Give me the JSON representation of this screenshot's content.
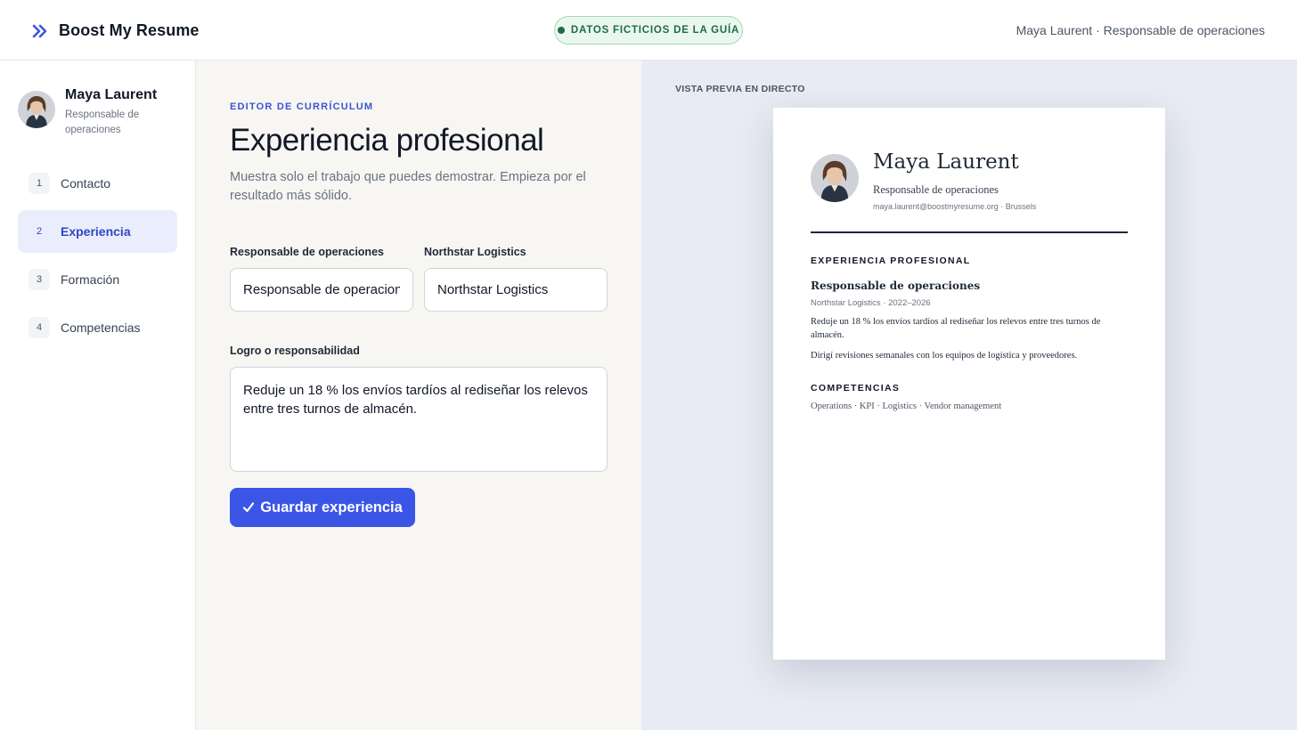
{
  "header": {
    "brand": "Boost My Resume",
    "brand_icon": "double-chevron-right-icon",
    "badge": "DATOS FICTICIOS DE LA GUÍA",
    "user_summary": "Maya Laurent · Responsable de operaciones"
  },
  "sidebar": {
    "profile": {
      "name": "Maya Laurent",
      "role": "Responsable de operaciones"
    },
    "steps": [
      {
        "number": "1",
        "label": "Contacto",
        "active": false
      },
      {
        "number": "2",
        "label": "Experiencia",
        "active": true
      },
      {
        "number": "3",
        "label": "Formación",
        "active": false
      },
      {
        "number": "4",
        "label": "Competencias",
        "active": false
      }
    ]
  },
  "editor": {
    "eyebrow": "EDITOR DE CURRÍCULUM",
    "title": "Experiencia profesional",
    "subtitle": "Muestra solo el trabajo que puedes demostrar. Empieza por el resultado más sólido.",
    "role_label": "Responsable de operaciones",
    "role_value": "Responsable de operaciones",
    "company_label": "Northstar Logistics",
    "company_value": "Northstar Logistics",
    "achievement_label": "Logro o responsabilidad",
    "achievement_value": "Reduje un 18 % los envíos tardíos al rediseñar los relevos entre tres turnos de almacén.",
    "save_icon": "check-icon",
    "save_label": "Guardar experiencia"
  },
  "preview": {
    "label": "VISTA PREVIA EN DIRECTO",
    "cv": {
      "name": "Maya Laurent",
      "role": "Responsable de operaciones",
      "contact": "maya.laurent@boostmyresume.org · Brussels",
      "experience_heading": "EXPERIENCIA PROFESIONAL",
      "job_title": "Responsable de operaciones",
      "job_meta": "Northstar Logistics · 2022–2026",
      "bullet_1": "Reduje un 18 % los envíos tardíos al rediseñar los relevos entre tres turnos de almacén.",
      "bullet_2": "Dirigí revisiones semanales con los equipos de logística y proveedores.",
      "skills_heading": "COMPETENCIAS",
      "skills": "Operations · KPI · Logistics · Vendor management"
    }
  },
  "colors": {
    "accent": "#3b55e6",
    "badge_green": "#1f6b43",
    "preview_bg": "#e8ebf3",
    "editor_bg": "#f7f6f3"
  }
}
